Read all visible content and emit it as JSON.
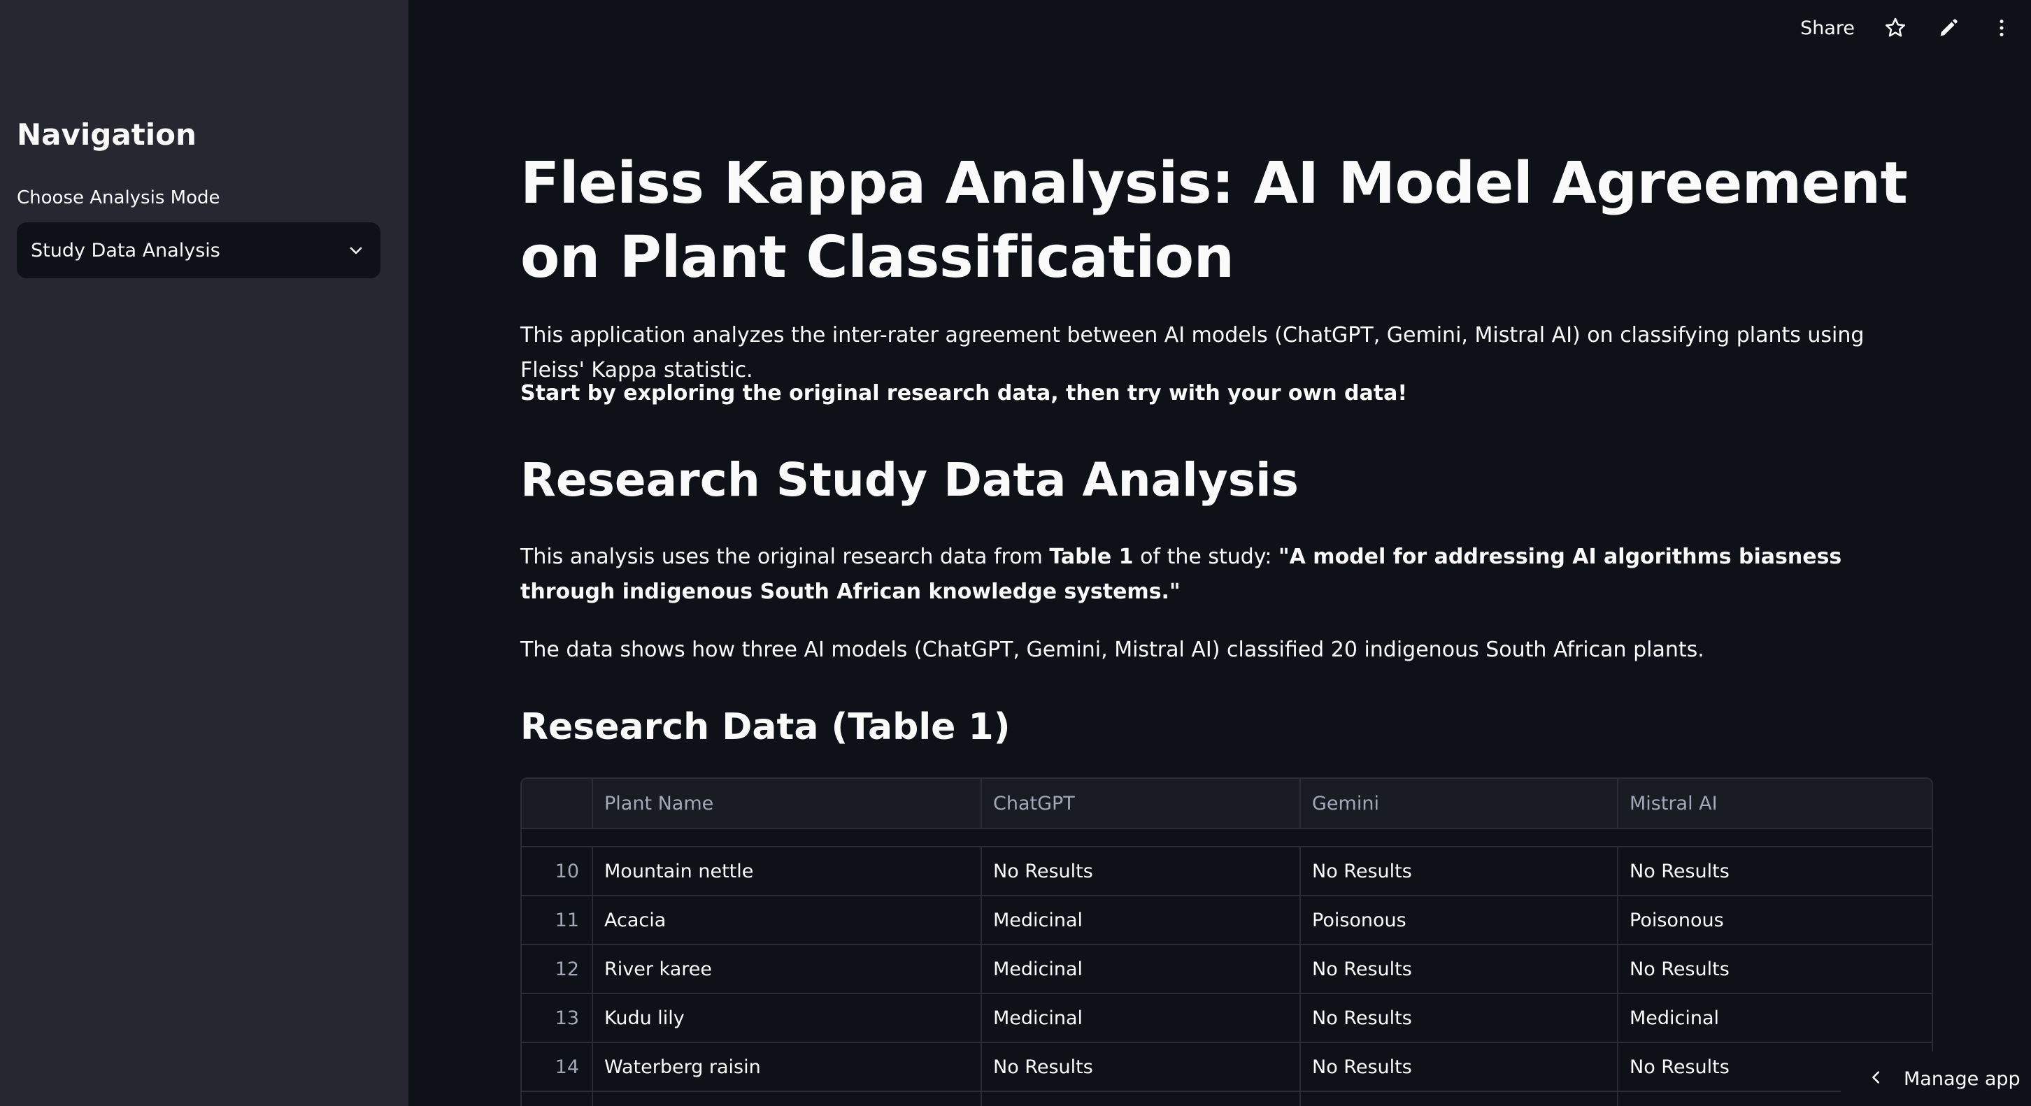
{
  "sidebar": {
    "title": "Navigation",
    "select_label": "Choose Analysis Mode",
    "select_value": "Study Data Analysis"
  },
  "toolbar": {
    "share_label": "Share",
    "icons": [
      "star-icon",
      "pencil-icon",
      "more-vertical-icon"
    ]
  },
  "main": {
    "title": "Fleiss Kappa Analysis: AI Model Agreement on Plant Classification",
    "intro": "This application analyzes the inter-rater agreement between AI models (ChatGPT, Gemini, Mistral AI) on classifying plants using Fleiss' Kappa statistic.",
    "cta": "Start by exploring the original research data, then try with your own data!",
    "section_title": "Research Study Data Analysis",
    "study_text_prefix": "This analysis uses the original research data from ",
    "study_table_ref": "Table 1",
    "study_text_mid": " of the study: ",
    "study_title": "\"A model for addressing AI algorithms biasness through indigenous South African knowledge systems.\"",
    "data_desc": "The data shows how three AI models (ChatGPT, Gemini, Mistral AI) classified 20 indigenous South African plants.",
    "table_heading": "Research Data (Table 1)"
  },
  "table": {
    "columns": [
      "Plant Name",
      "ChatGPT",
      "Gemini",
      "Mistral AI"
    ],
    "rows": [
      {
        "index": "10",
        "plant": "Mountain nettle",
        "chatgpt": "No Results",
        "gemini": "No Results",
        "mistral": "No Results"
      },
      {
        "index": "11",
        "plant": "Acacia",
        "chatgpt": "Medicinal",
        "gemini": "Poisonous",
        "mistral": "Poisonous"
      },
      {
        "index": "12",
        "plant": "River karee",
        "chatgpt": "Medicinal",
        "gemini": "No Results",
        "mistral": "No Results"
      },
      {
        "index": "13",
        "plant": "Kudu lily",
        "chatgpt": "Medicinal",
        "gemini": "No Results",
        "mistral": "Medicinal"
      },
      {
        "index": "14",
        "plant": "Waterberg raisin",
        "chatgpt": "No Results",
        "gemini": "No Results",
        "mistral": "No Results"
      }
    ]
  },
  "footer": {
    "manage_label": "Manage app"
  }
}
